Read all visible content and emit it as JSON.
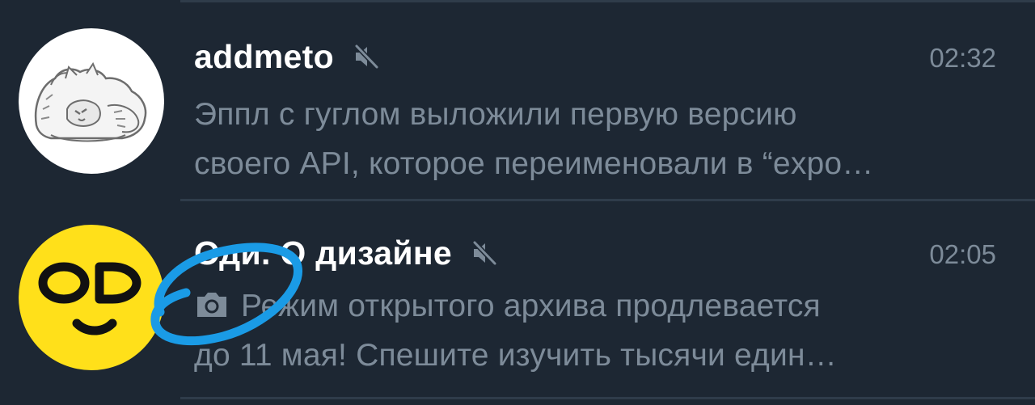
{
  "chats": [
    {
      "name": "addmeto",
      "time": "02:32",
      "preview_line1": "Эппл с гуглом выложили первую версию",
      "preview_line2": "своего API, которое переименовали в “expo…",
      "muted": true,
      "avatar": "cat-sticker-avatar"
    },
    {
      "name": "Оди. О дизайне",
      "time": "02:05",
      "preview_line1": "Режим открытого архива продлевается",
      "preview_line2": "до 11 мая! Спешите изучить тысячи един…",
      "muted": true,
      "has_photo": true,
      "avatar_text": "OD"
    }
  ],
  "colors": {
    "background": "#1d2733",
    "name": "#ffffff",
    "secondary_text": "#7d8b99",
    "avatar_yellow": "#ffe01a",
    "annotation": "#1a9be6"
  }
}
